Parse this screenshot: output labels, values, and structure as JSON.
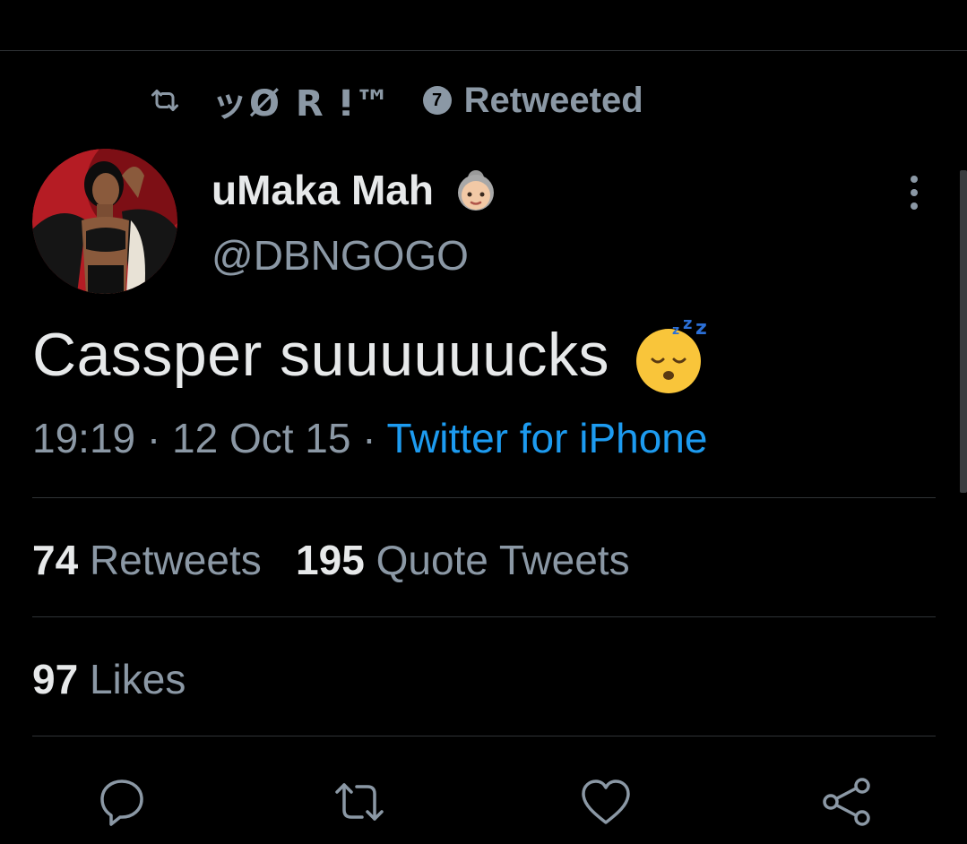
{
  "retweet_header": {
    "retweeter_name": "ッØ R ⵑ™",
    "badge_number": "7",
    "label": "Retweeted"
  },
  "author": {
    "display_name": "uMaka Mah",
    "name_emoji": "older-woman-emoji",
    "handle": "@DBNGOGO"
  },
  "tweet": {
    "text": "Cassper suuuuuucks",
    "emoji": "sleeping-face-emoji"
  },
  "meta": {
    "time": "19:19",
    "separator_1": "·",
    "date": "12 Oct 15",
    "separator_2": "·",
    "source": "Twitter for iPhone"
  },
  "stats": {
    "retweets_count": "74",
    "retweets_label": "Retweets",
    "quote_count": "195",
    "quote_label": "Quote Tweets",
    "likes_count": "97",
    "likes_label": "Likes"
  },
  "actions": {
    "icons": [
      "reply-icon",
      "retweet-icon",
      "like-icon",
      "share-icon"
    ]
  },
  "colors": {
    "background": "#000000",
    "primary_text": "#e7e9ea",
    "secondary_text": "#8b98a5",
    "link": "#1d9bf0",
    "divider": "#2f3336"
  }
}
